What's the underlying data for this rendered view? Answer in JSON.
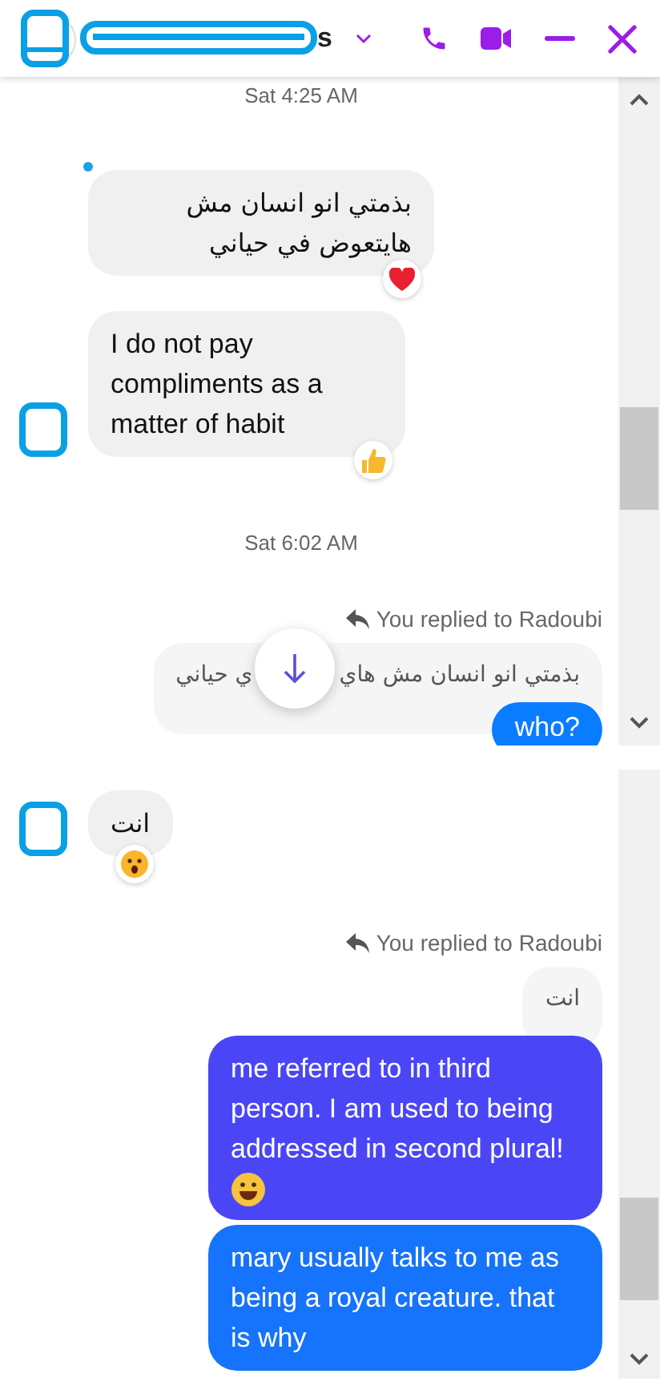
{
  "header": {
    "title": "s"
  },
  "panels": [
    {
      "scroll_down_button": true,
      "items": [
        {
          "kind": "timestamp",
          "text": "Sat 4:25 AM"
        },
        {
          "kind": "incoming",
          "text": "بذمتي انو انسان مش هايتعوض في حياني",
          "rtl": true,
          "avatar": false,
          "unread_dot": true,
          "reaction": {
            "kind": "heart"
          }
        },
        {
          "kind": "incoming",
          "text": "I do not pay compliments as a matter of habit",
          "rtl": false,
          "avatar": true,
          "unread_dot": false,
          "reaction": {
            "kind": "thumbs_up"
          }
        },
        {
          "kind": "timestamp",
          "text": "Sat 6:02 AM"
        },
        {
          "kind": "reply_label",
          "text": "You replied to Radoubi"
        },
        {
          "kind": "quote",
          "parts": [
            "بذمتي انو انسان مش هاي",
            "ي حياني"
          ]
        },
        {
          "kind": "outgoing",
          "text": "who?",
          "color": "#0a7cff"
        }
      ]
    },
    {
      "scroll_down_button": false,
      "items": [
        {
          "kind": "incoming",
          "text": "انت",
          "rtl": true,
          "avatar": true,
          "unread_dot": false,
          "reaction": {
            "kind": "surprised"
          }
        },
        {
          "kind": "reply_label",
          "text": "You replied to Radoubi"
        },
        {
          "kind": "quote",
          "parts": [
            "انت"
          ]
        },
        {
          "kind": "outgoing",
          "text": "me referred to in third person. I am used to being addressed in second plural!",
          "emoji": {
            "kind": "smile"
          },
          "color": "#4a46f6"
        },
        {
          "kind": "outgoing",
          "text": "mary usually talks to me as being a royal creature. that is why",
          "color": "#1673fb"
        }
      ]
    }
  ]
}
